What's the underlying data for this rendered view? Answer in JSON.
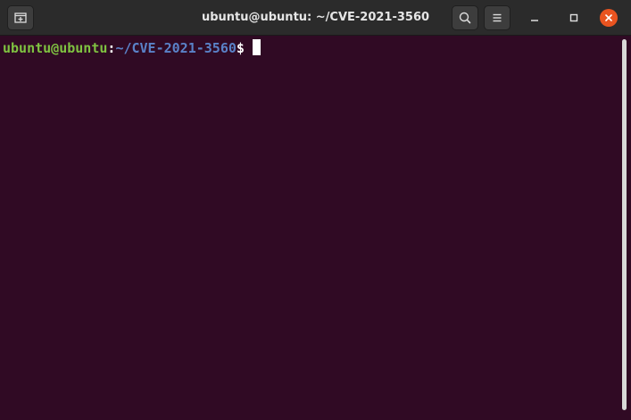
{
  "window": {
    "title": "ubuntu@ubuntu: ~/CVE-2021-3560"
  },
  "headerbar": {
    "new_tab_icon": "new-tab-icon",
    "search_icon": "search-icon",
    "menu_icon": "hamburger-menu-icon",
    "controls": [
      "minimize-icon",
      "maximize-icon",
      "close-icon"
    ]
  },
  "terminal": {
    "prompt": {
      "user_host": "ubuntu@ubuntu",
      "colon": ":",
      "path": "~/CVE-2021-3560",
      "symbol": "$"
    }
  },
  "colors": {
    "terminal_bg": "#300a24",
    "headerbar_bg": "#2b2b2b",
    "user_host": "#7fc241",
    "path": "#5a82c8",
    "close_button": "#e95420"
  }
}
